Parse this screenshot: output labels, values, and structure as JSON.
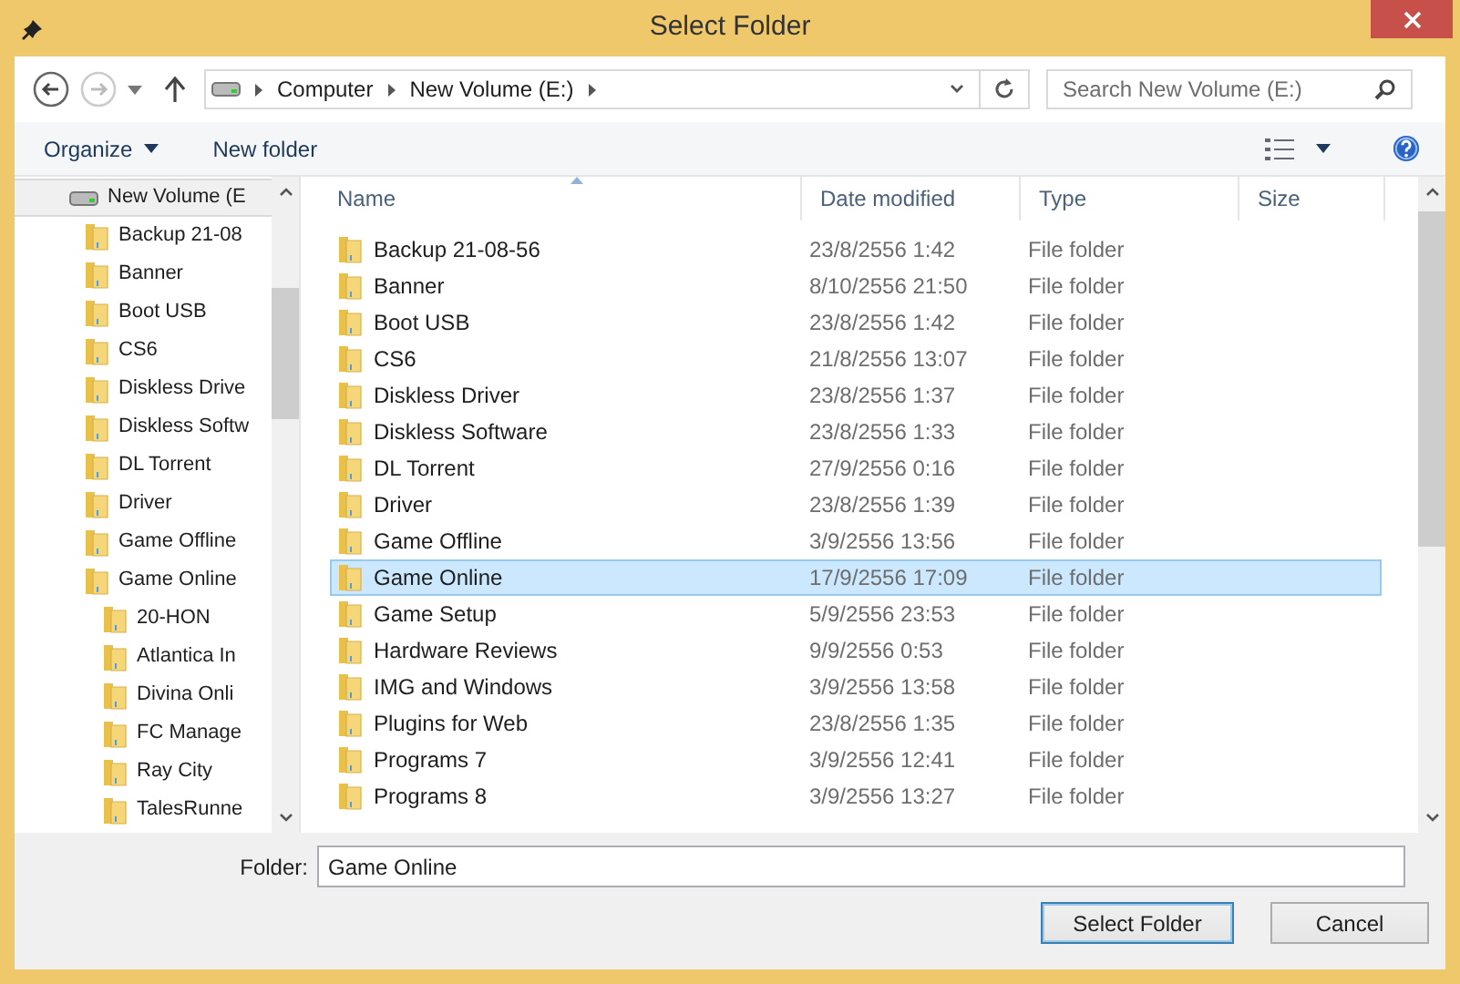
{
  "window": {
    "title": "Select Folder"
  },
  "address": {
    "crumbs": [
      "Computer",
      "New Volume (E:)"
    ]
  },
  "search": {
    "placeholder": "Search New Volume (E:)"
  },
  "toolbar": {
    "organize": "Organize",
    "new_folder": "New folder"
  },
  "sidebar": {
    "tree": [
      {
        "label": "New Volume (E",
        "kind": "drive",
        "selected": true,
        "children": [
          {
            "label": "Backup 21-08",
            "kind": "folder",
            "selected": false
          },
          {
            "label": "Banner",
            "kind": "folder",
            "selected": false
          },
          {
            "label": "Boot USB",
            "kind": "folder",
            "selected": false
          },
          {
            "label": "CS6",
            "kind": "folder",
            "selected": false
          },
          {
            "label": "Diskless Drive",
            "kind": "folder",
            "selected": false
          },
          {
            "label": "Diskless Softw",
            "kind": "folder",
            "selected": false
          },
          {
            "label": "DL Torrent",
            "kind": "folder",
            "selected": false
          },
          {
            "label": "Driver",
            "kind": "folder",
            "selected": false
          },
          {
            "label": "Game Offline",
            "kind": "folder",
            "selected": false
          },
          {
            "label": "Game Online",
            "kind": "folder",
            "selected": false,
            "children": [
              {
                "label": "20-HON",
                "kind": "folder",
                "selected": false
              },
              {
                "label": "Atlantica In",
                "kind": "folder",
                "selected": false
              },
              {
                "label": "Divina Onli",
                "kind": "folder",
                "selected": false
              },
              {
                "label": "FC Manage",
                "kind": "folder",
                "selected": false
              },
              {
                "label": "Ray City",
                "kind": "folder",
                "selected": false
              },
              {
                "label": "TalesRunne",
                "kind": "folder",
                "selected": false
              }
            ]
          }
        ]
      }
    ]
  },
  "table": {
    "columns": [
      {
        "label": "Name",
        "sorted": true
      },
      {
        "label": "Date modified",
        "sorted": false
      },
      {
        "label": "Type",
        "sorted": false
      },
      {
        "label": "Size",
        "sorted": false
      }
    ],
    "rows": [
      {
        "name": "Backup 21-08-56",
        "date": "23/8/2556 1:42",
        "type": "File folder",
        "selected": false
      },
      {
        "name": "Banner",
        "date": "8/10/2556 21:50",
        "type": "File folder",
        "selected": false
      },
      {
        "name": "Boot USB",
        "date": "23/8/2556 1:42",
        "type": "File folder",
        "selected": false
      },
      {
        "name": "CS6",
        "date": "21/8/2556 13:07",
        "type": "File folder",
        "selected": false
      },
      {
        "name": "Diskless Driver",
        "date": "23/8/2556 1:37",
        "type": "File folder",
        "selected": false
      },
      {
        "name": "Diskless Software",
        "date": "23/8/2556 1:33",
        "type": "File folder",
        "selected": false
      },
      {
        "name": "DL Torrent",
        "date": "27/9/2556 0:16",
        "type": "File folder",
        "selected": false
      },
      {
        "name": "Driver",
        "date": "23/8/2556 1:39",
        "type": "File folder",
        "selected": false
      },
      {
        "name": "Game Offline",
        "date": "3/9/2556 13:56",
        "type": "File folder",
        "selected": false
      },
      {
        "name": "Game Online",
        "date": "17/9/2556 17:09",
        "type": "File folder",
        "selected": true
      },
      {
        "name": "Game Setup",
        "date": "5/9/2556 23:53",
        "type": "File folder",
        "selected": false
      },
      {
        "name": "Hardware Reviews",
        "date": "9/9/2556 0:53",
        "type": "File folder",
        "selected": false
      },
      {
        "name": "IMG and Windows",
        "date": "3/9/2556 13:58",
        "type": "File folder",
        "selected": false
      },
      {
        "name": "Plugins for Web",
        "date": "23/8/2556 1:35",
        "type": "File folder",
        "selected": false
      },
      {
        "name": "Programs 7",
        "date": "3/9/2556 12:41",
        "type": "File folder",
        "selected": false
      },
      {
        "name": "Programs 8",
        "date": "3/9/2556 13:27",
        "type": "File folder",
        "selected": false
      }
    ]
  },
  "folder": {
    "label": "Folder:",
    "value": "Game Online"
  },
  "buttons": [
    {
      "label": "Select Folder",
      "default": true
    },
    {
      "label": "Cancel",
      "default": false
    }
  ]
}
